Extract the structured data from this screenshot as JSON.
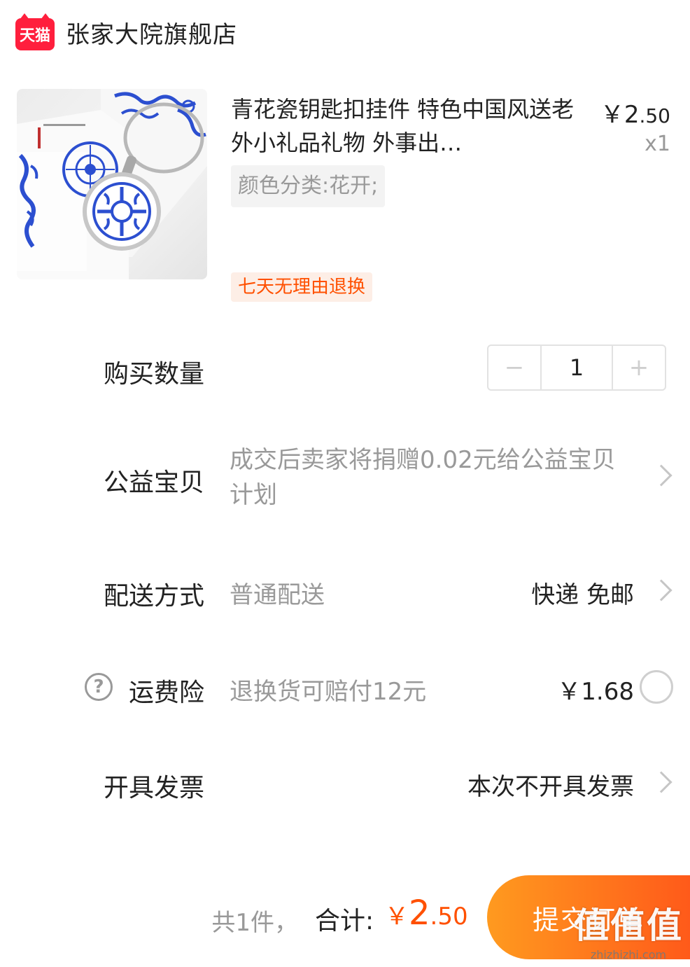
{
  "shop": {
    "badge": "天猫",
    "name": "张家大院旗舰店"
  },
  "product": {
    "title": "青花瓷钥匙扣挂件 特色中国风送老外小礼品礼物 外事出…",
    "price_currency": "￥",
    "price_int": "2",
    "price_dec": ".50",
    "quantity": "x1",
    "sku": "颜色分类:花开;",
    "return_tag": "七天无理由退换"
  },
  "quantity_row": {
    "label": "购买数量",
    "minus": "−",
    "value": "1",
    "plus": "+"
  },
  "charity_row": {
    "label": "公益宝贝",
    "text": "成交后卖家将捐赠0.02元给公益宝贝计划"
  },
  "delivery_row": {
    "label": "配送方式",
    "method": "普通配送",
    "value": "快递 免邮"
  },
  "insurance_row": {
    "help": "?",
    "label": "运费险",
    "text": "退换货可赔付12元",
    "price": "￥1.68"
  },
  "invoice_row": {
    "label": "开具发票",
    "value": "本次不开具发票"
  },
  "bottom": {
    "count": "共1件，",
    "total_label": "合计:",
    "total_currency": "￥",
    "total_int": "2",
    "total_dec": ".50",
    "submit": "提交订单",
    "watermark_big": "值值值",
    "watermark_small": "zhizhizhi.com"
  },
  "colors": {
    "accent": "#ff5000",
    "brand_tmall": "#ff1f3d",
    "muted": "#999999"
  }
}
